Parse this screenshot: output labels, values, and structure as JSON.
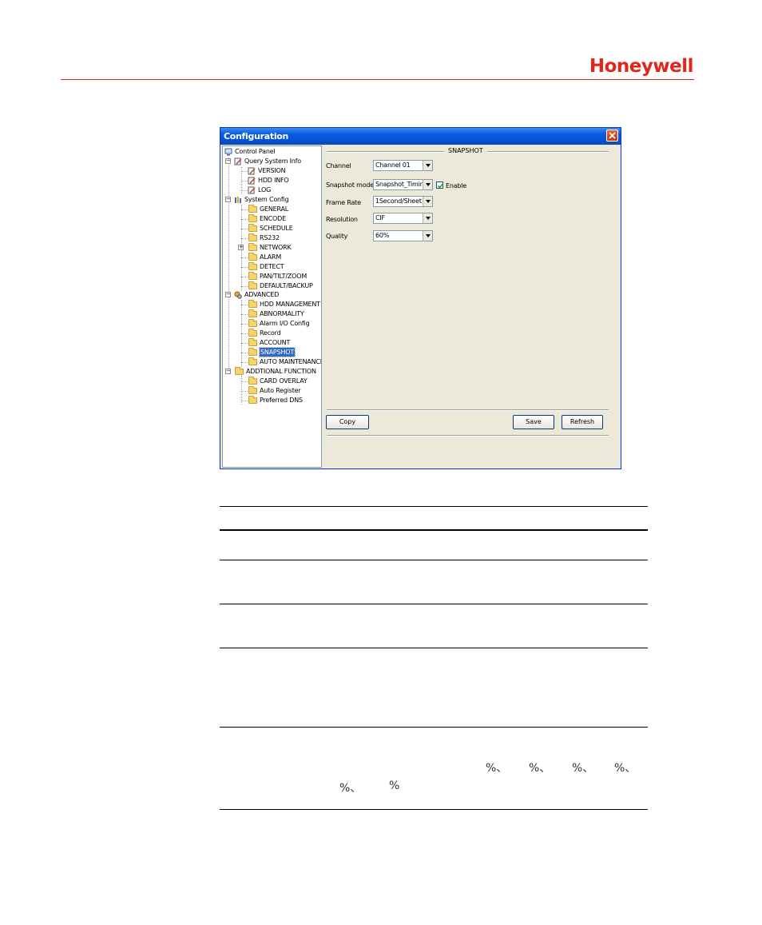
{
  "brand": {
    "logo_text": "Honeywell",
    "color": "#e1261c"
  },
  "window": {
    "title": "Configuration",
    "close_icon": "close-icon"
  },
  "tree": {
    "root": "Control Panel",
    "query_system_info": {
      "label": "Query System Info",
      "children": [
        "VERSION",
        "HDD INFO",
        "LOG"
      ]
    },
    "system_config": {
      "label": "System Config",
      "children": [
        "GENERAL",
        "ENCODE",
        "SCHEDULE",
        "RS232",
        "NETWORK",
        "ALARM",
        "DETECT",
        "PAN/TILT/ZOOM",
        "DEFAULT/BACKUP"
      ]
    },
    "advanced": {
      "label": "ADVANCED",
      "children": [
        "HDD MANAGEMENT",
        "ABNORMALITY",
        "Alarm I/O Config",
        "Record",
        "ACCOUNT",
        "SNAPSHOT",
        "AUTO MAINTENANCE"
      ]
    },
    "additional_function": {
      "label": "ADDTIONAL FUNCTION",
      "children": [
        "CARD OVERLAY",
        "Auto Register",
        "Preferred DNS"
      ]
    },
    "selected": "SNAPSHOT"
  },
  "snapshot": {
    "group_title": "SNAPSHOT",
    "channel_label": "Channel",
    "channel_value": "Channel 01",
    "mode_label": "Snapshot mode",
    "mode_value": "Snapshot_Timing",
    "enable_label": "Enable",
    "enable_checked": true,
    "frame_rate_label": "Frame Rate",
    "frame_rate_value": "1Second/Sheet",
    "resolution_label": "Resolution",
    "resolution_value": "CIF",
    "quality_label": "Quality",
    "quality_value": "60%",
    "copy_label": "Copy",
    "save_label": "Save",
    "refresh_label": "Refresh"
  },
  "table": {
    "quality_marks_line1": [
      "%、",
      "%、",
      "%、",
      "%、"
    ],
    "quality_marks_line2": [
      "%、",
      "%"
    ]
  }
}
